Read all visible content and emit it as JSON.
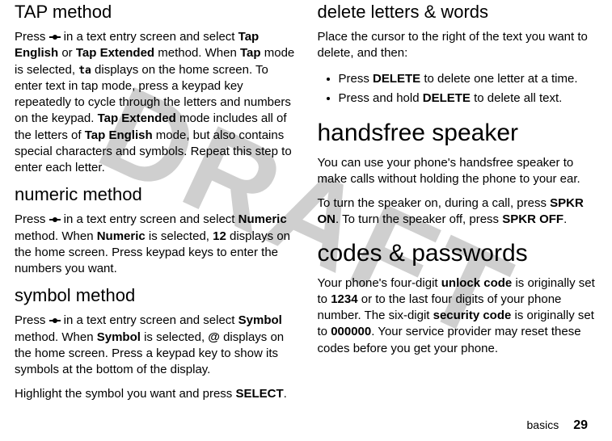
{
  "watermark": "DRAFT",
  "left": {
    "tap_heading": "TAP method",
    "tap_body_1a": "Press ",
    "tap_body_1b": " in a text entry screen and select ",
    "tap_english": "Tap English",
    "tap_body_1c": " or ",
    "tap_extended": "Tap Extended",
    "tap_body_1d": " method. When ",
    "tap_label": "Tap",
    "tap_body_1e": " mode is selected, ",
    "tap_icon": "ta",
    "tap_body_1f": " displays on the home screen. To enter text in tap mode, press a keypad key repeatedly to cycle through the letters and numbers on the keypad. ",
    "tap_body_1g": " mode includes all of the letters of ",
    "tap_body_1h": " mode, but also contains special characters and symbols. Repeat this step to enter each letter.",
    "num_heading": "numeric method",
    "num_1a": "Press ",
    "num_1b": " in a text entry screen and select ",
    "num_label": "Numeric",
    "num_1c": " method. When ",
    "num_1d": " is selected, ",
    "num_indicator": "12",
    "num_1e": " displays on the home screen. Press keypad keys to enter the numbers you want.",
    "sym_heading": "symbol method",
    "sym_1a": "Press ",
    "sym_1b": " in a text entry screen and select ",
    "sym_label": "Symbol",
    "sym_1c": " method. When ",
    "sym_1d": " is selected, ",
    "sym_indicator": "@",
    "sym_1e": " displays on the home screen. Press a keypad key to show its symbols at the bottom of the display.",
    "sym_2a": "Highlight the symbol you want and press ",
    "select_label": "SELECT",
    "sym_2b": "."
  },
  "right": {
    "del_heading": "delete letters & words",
    "del_intro": "Place the cursor to the right of the text you want to delete, and then:",
    "del_b1a": "Press ",
    "delete_label": "DELETE",
    "del_b1b": " to delete one letter at a time.",
    "del_b2a": "Press and hold ",
    "del_b2b": " to delete all text.",
    "hf_heading": "handsfree speaker",
    "hf_p1": "You can use your phone's handsfree speaker to make calls without holding the phone to your ear.",
    "hf_p2a": "To turn the speaker on, during a call, press ",
    "spkr_on": "SPKR ON",
    "hf_p2b": ". To turn the speaker off, press ",
    "spkr_off": "SPKR OFF",
    "hf_p2c": ".",
    "codes_heading": "codes & passwords",
    "codes_p1a": "Your phone's four-digit ",
    "unlock_code": "unlock code",
    "codes_p1b": " is originally set to ",
    "code_1234": "1234",
    "codes_p1c": " or to the last four digits of your phone number. The six-digit ",
    "security_code": "security code",
    "codes_p1d": " is originally set to ",
    "code_000000": "000000",
    "codes_p1e": ". Your service provider may reset these codes before you get your phone."
  },
  "footer": {
    "label": "basics",
    "page": "29"
  }
}
